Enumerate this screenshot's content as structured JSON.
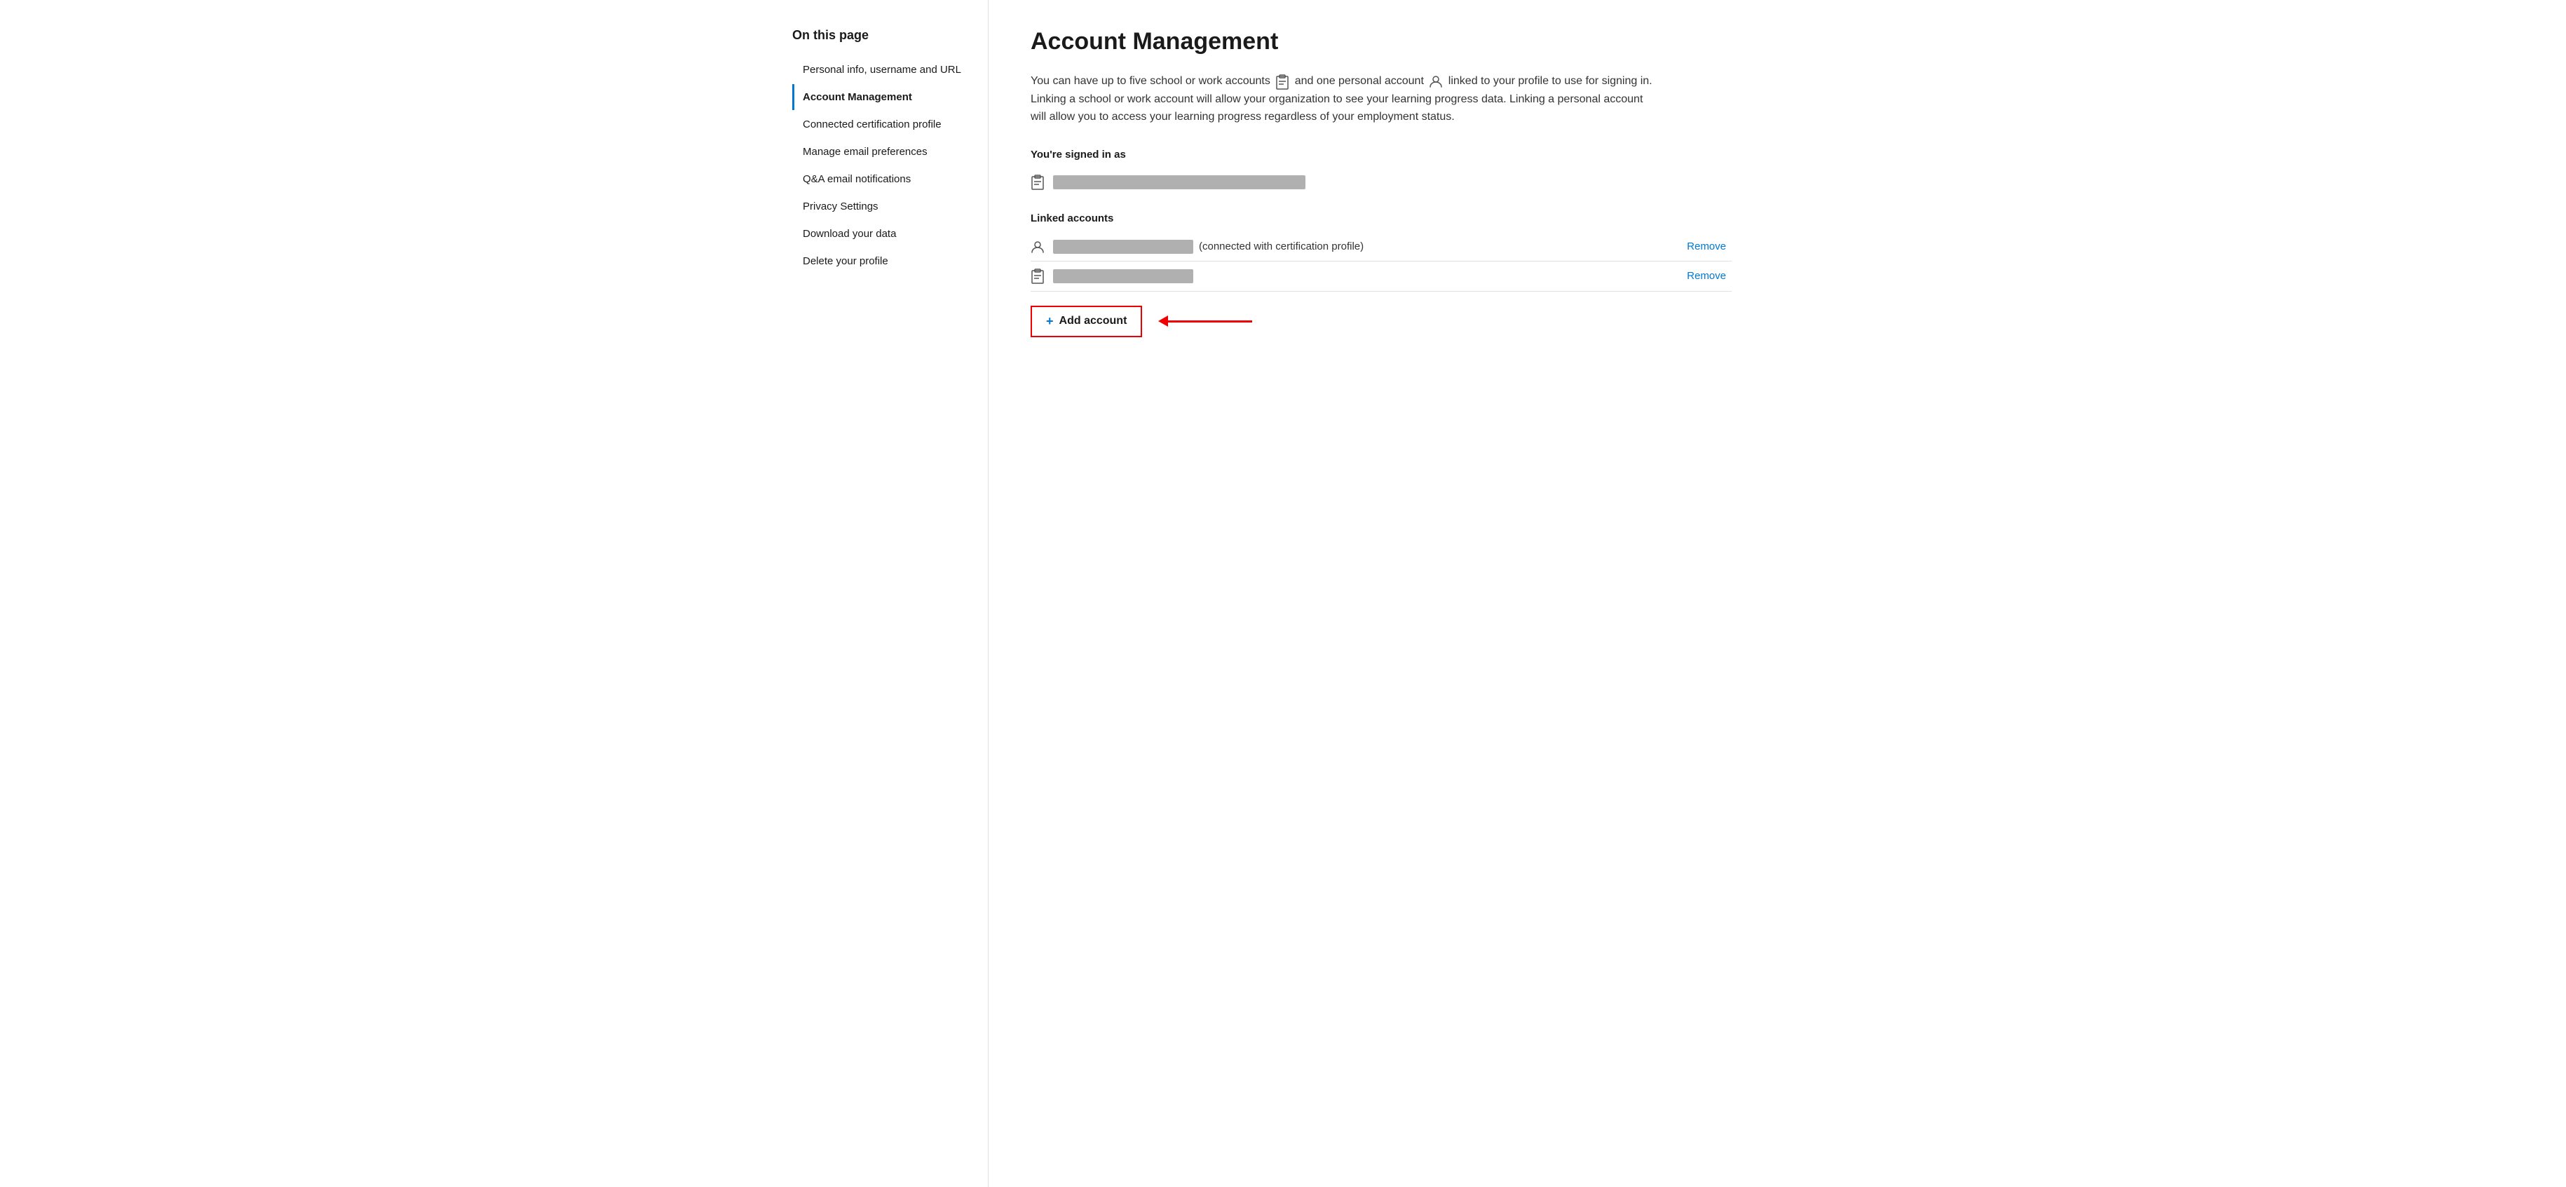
{
  "sidebar": {
    "heading": "On this page",
    "items": [
      {
        "id": "personal-info",
        "label": "Personal info, username and URL",
        "active": false
      },
      {
        "id": "account-management",
        "label": "Account Management",
        "active": true
      },
      {
        "id": "connected-certification",
        "label": "Connected certification profile",
        "active": false
      },
      {
        "id": "manage-email",
        "label": "Manage email preferences",
        "active": false
      },
      {
        "id": "qa-email",
        "label": "Q&A email notifications",
        "active": false
      },
      {
        "id": "privacy-settings",
        "label": "Privacy Settings",
        "active": false
      },
      {
        "id": "download-data",
        "label": "Download your data",
        "active": false
      },
      {
        "id": "delete-profile",
        "label": "Delete your profile",
        "active": false
      }
    ]
  },
  "main": {
    "title": "Account Management",
    "description_part1": "You can have up to five school or work accounts",
    "description_part2": "and one personal account",
    "description_part3": "linked to your profile to use for signing in. Linking a school or work account will allow your organization to see your learning progress data. Linking a personal account will allow you to access your learning progress regardless of your employment status.",
    "signed_in_label": "You're signed in as",
    "linked_accounts_label": "Linked accounts",
    "cert_label": "(connected with certification profile)",
    "remove_label": "Remove",
    "add_account_label": "Add account"
  }
}
